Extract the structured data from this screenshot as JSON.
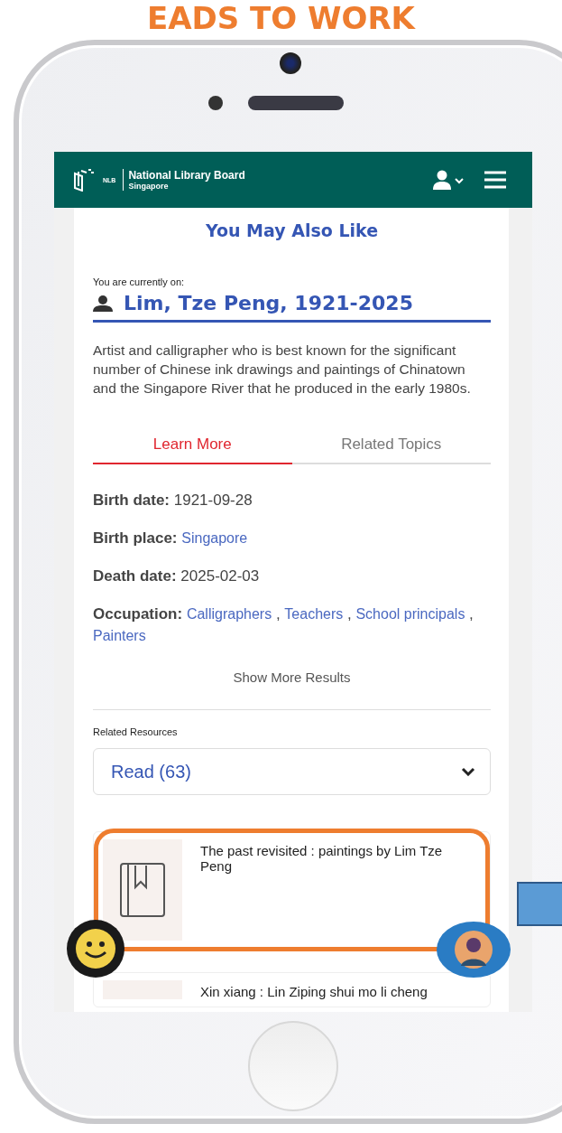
{
  "banner": {
    "text": "EADS TO WORK"
  },
  "header": {
    "logo_text": "NLB",
    "brand": "National Library Board",
    "sub": "Singapore"
  },
  "section_title": "You May Also Like",
  "current": {
    "label": "You are currently on:",
    "name": "Lim, Tze Peng, 1921-2025",
    "description": "Artist and calligrapher who is best known for the significant number of Chinese ink drawings and paintings of Chinatown and the Singapore River that he produced in the early 1980s."
  },
  "tabs": [
    {
      "label": "Learn More",
      "selected": true
    },
    {
      "label": "Related Topics",
      "selected": false
    }
  ],
  "facts": [
    {
      "kind": "text",
      "label": "Birth date:",
      "value": "1921-09-28"
    },
    {
      "kind": "links",
      "label": "Birth place:",
      "links": [
        "Singapore"
      ]
    },
    {
      "kind": "text",
      "label": "Death date:",
      "value": "2025-02-03"
    },
    {
      "kind": "links",
      "label": "Occupation:",
      "links": [
        "Calligraphers",
        "Teachers",
        "School principals",
        "Painters"
      ]
    }
  ],
  "link_separator": ",",
  "show_more": "Show More Results",
  "related": {
    "label": "Related Resources",
    "select": "Read (63)",
    "items": [
      {
        "title": "The past revisited : paintings by Lim Tze Peng"
      },
      {
        "title": "Xin xiang : Lin Ziping shui mo li cheng"
      }
    ]
  }
}
